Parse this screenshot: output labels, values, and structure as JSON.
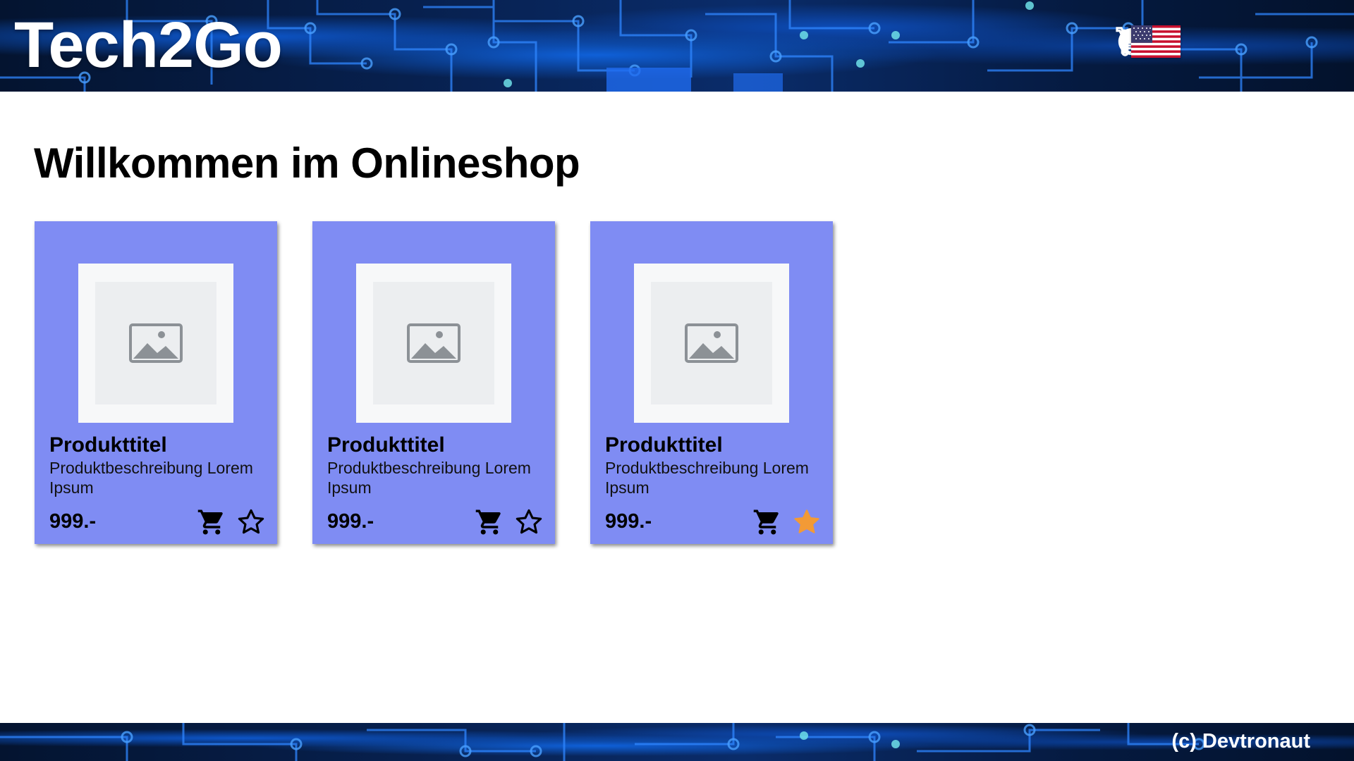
{
  "header": {
    "logo": "Tech2Go",
    "nav": [
      {
        "icon": "home-icon"
      },
      {
        "icon": "shopping-cart-icon"
      },
      {
        "icon": "account-circle-icon"
      },
      {
        "icon": "logout-icon"
      }
    ],
    "language_flag": "us-flag-icon"
  },
  "main": {
    "heading": "Willkommen im Onlineshop",
    "products": [
      {
        "title": "Produkttitel",
        "description": "Produktbeschreibung Lorem Ipsum",
        "price": "999.-",
        "favorite": false
      },
      {
        "title": "Produkttitel",
        "description": "Produktbeschreibung Lorem Ipsum",
        "price": "999.-",
        "favorite": false
      },
      {
        "title": "Produkttitel",
        "description": "Produktbeschreibung Lorem Ipsum",
        "price": "999.-",
        "favorite": true
      }
    ]
  },
  "footer": {
    "copyright": "(c) Devtronaut"
  },
  "colors": {
    "card_background": "#7f8cf3",
    "favorite_active": "#f29a36",
    "header_dark": "#07204e"
  }
}
